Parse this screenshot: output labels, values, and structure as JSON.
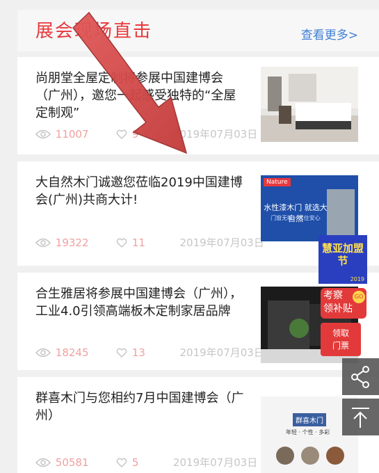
{
  "header": {
    "title": "展会现场直击",
    "more": "查看更多>"
  },
  "articles": [
    {
      "title": "尚朋堂全屋定制将参展中国建博会（广州），邀您一起感受独特的“全屋定制观”",
      "views": "11007",
      "likes": "9",
      "date": "2019年07月03日",
      "thumb": "white-bedroom-photo"
    },
    {
      "title": "大自然木门诚邀您莅临2019中国建博会(广州)共商大计!",
      "views": "19322",
      "likes": "11",
      "date": "2019年07月03日",
      "thumb": "nature-door-ad",
      "thumb_text": "水性漆木门 就选大自然",
      "thumb_sub": "门窗无味 · 居住安心",
      "thumb_logo": "Nature"
    },
    {
      "title": "合生雅居将参展中国建博会（广州），工业4.0引领高端板木定制家居品牌",
      "views": "18245",
      "likes": "13",
      "date": "2019年07月03日",
      "thumb": "exhibition-booth-photo"
    },
    {
      "title": "群喜木门与您相约7月中国建博会（广州）",
      "views": "50581",
      "likes": "5",
      "date": "2019年07月03日",
      "thumb": "qunxi-door-ad",
      "thumb_text": "群喜木门",
      "thumb_sub": "年轻 · 个性 · 多彩"
    }
  ],
  "floaters": {
    "franchise": "慧亚加盟节",
    "franchise_year": "2019",
    "subsidy_top": "考察",
    "subsidy_bottom": "领补贴",
    "subsidy_go": "GO",
    "ticket_top": "领取",
    "ticket_bottom": "门票"
  },
  "colors": {
    "accent": "#e8383d",
    "link": "#3f7fd6",
    "arrow": "#d24a4a"
  }
}
